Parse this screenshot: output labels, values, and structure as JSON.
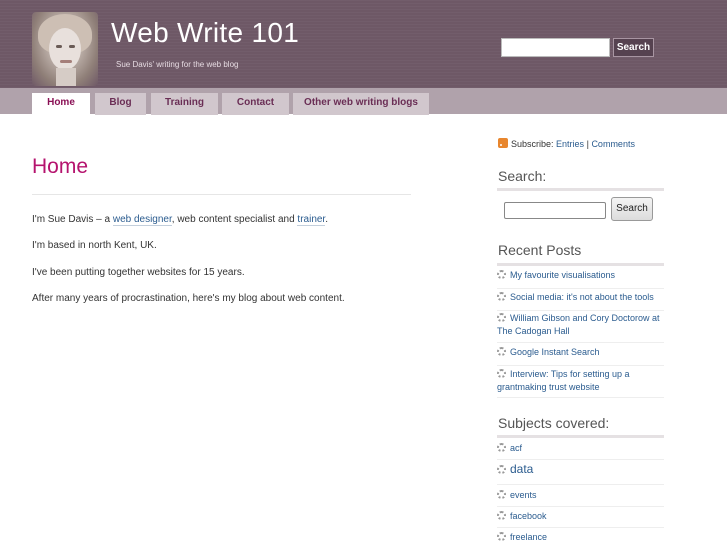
{
  "site": {
    "title": "Web Write 101",
    "tagline": "Sue Davis' writing for the web blog"
  },
  "header_search": {
    "value": "",
    "button_label": "Search"
  },
  "nav": {
    "tabs": [
      {
        "label": "Home",
        "active": true
      },
      {
        "label": "Blog",
        "active": false
      },
      {
        "label": "Training",
        "active": false
      },
      {
        "label": "Contact",
        "active": false
      },
      {
        "label": "Other web writing blogs",
        "active": false
      }
    ]
  },
  "main": {
    "title": "Home",
    "p1": {
      "before": "I'm Sue Davis – a ",
      "link1": "web designer",
      "middle": ", web content specialist and ",
      "link2": "trainer",
      "after": "."
    },
    "p2": "I'm based in north Kent, UK.",
    "p3": "I've been putting together websites for 15 years.",
    "p4": "After many years of procrastination, here's my blog about web content."
  },
  "sidebar": {
    "subscribe": {
      "label": "Subscribe:",
      "entries": "Entries",
      "sep": "|",
      "comments": "Comments"
    },
    "search_heading": "Search:",
    "search_button": "Search",
    "recent_heading": "Recent Posts",
    "recent_posts": [
      "My favourite visualisations",
      "Social media: it's not about the tools",
      "William Gibson and Cory Doctorow at The Cadogan Hall",
      "Google Instant Search",
      "Interview: Tips for setting up a grantmaking trust website"
    ],
    "subjects_heading": "Subjects covered:",
    "subjects": [
      "acf",
      "data",
      "events",
      "facebook",
      "freelance"
    ]
  },
  "colors": {
    "header_bg": "#6e5866",
    "nav_bg": "#b0a2ab",
    "accent_title": "#b5136e",
    "link": "#2b5c8f"
  }
}
